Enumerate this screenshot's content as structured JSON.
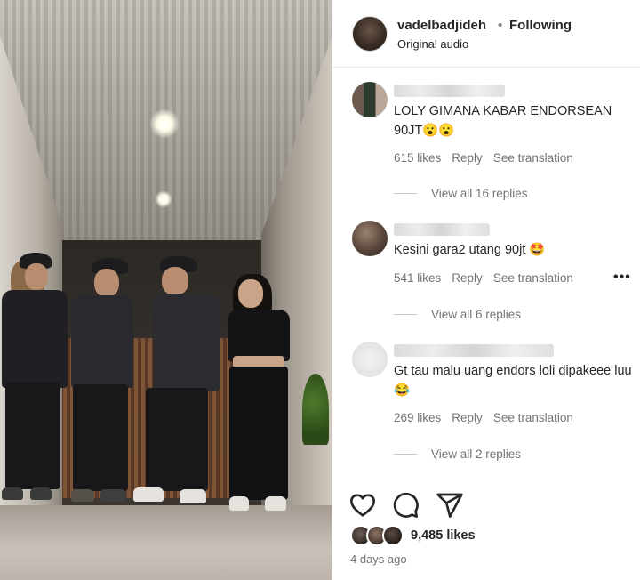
{
  "post": {
    "username": "vadelbadjideh",
    "separator": "•",
    "follow_status": "Following",
    "audio": "Original audio"
  },
  "comments": [
    {
      "text": "LOLY GIMANA KABAR ENDORSEAN 90JT😮😮",
      "likes": "615 likes",
      "reply": "Reply",
      "translate": "See translation",
      "view_replies": "View all 16 replies"
    },
    {
      "text": "Kesini gara2 utang 90jt 🤩",
      "likes": "541 likes",
      "reply": "Reply",
      "translate": "See translation",
      "more": "•••",
      "view_replies": "View all 6 replies"
    },
    {
      "text": "Gt tau malu uang endors loli dipakeee luu😂",
      "likes": "269 likes",
      "reply": "Reply",
      "translate": "See translation",
      "view_replies": "View all 2 replies"
    }
  ],
  "footer": {
    "likes": "9,485 likes",
    "date": "4 days ago"
  },
  "icons": {
    "like": "heart-icon",
    "comment": "speech-bubble-icon",
    "share": "paper-plane-icon"
  }
}
